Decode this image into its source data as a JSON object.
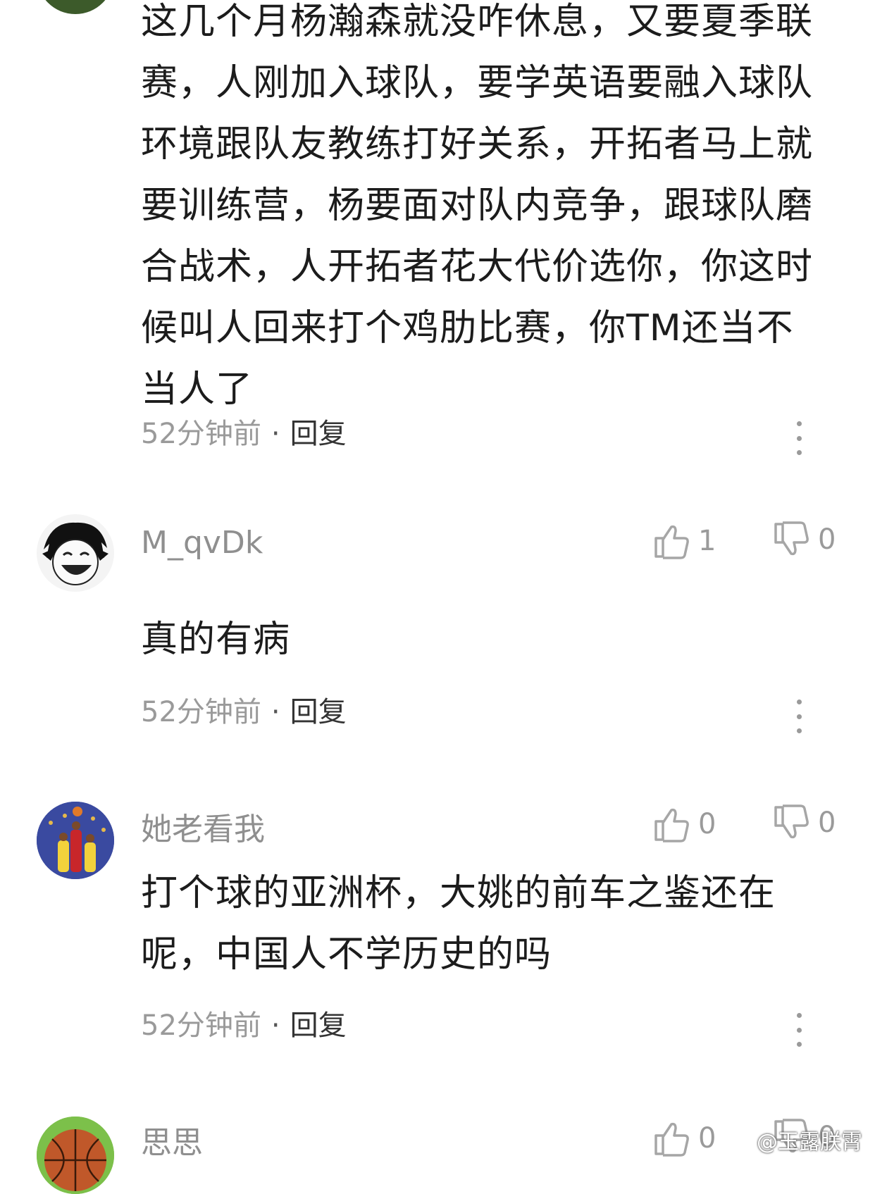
{
  "comments": [
    {
      "text": "这几个月杨瀚森就没咋休息，又要夏季联赛，人刚加入球队，要学英语要融入球队环境跟队友教练打好关系，开拓者马上就要训练营，杨要面对队内竞争，跟球队磨合战术，人开拓者花大代价选你，你这时候叫人回来打个鸡肋比赛，你TM还当不当人了",
      "time": "52分钟前",
      "reply": "回复"
    },
    {
      "username": "M_qvDk",
      "likes": "1",
      "dislikes": "0",
      "text": "真的有病",
      "time": "52分钟前",
      "reply": "回复"
    },
    {
      "username": "她老看我",
      "likes": "0",
      "dislikes": "0",
      "text": "打个球的亚洲杯，大姚的前车之鉴还在呢，中国人不学历史的吗",
      "time": "52分钟前",
      "reply": "回复"
    },
    {
      "username": "思思",
      "likes": "0",
      "dislikes": "0"
    }
  ],
  "separator": "·",
  "watermark": "@玉露朕霄",
  "icons": {
    "like": "thumbs-up-icon",
    "dislike": "thumbs-down-icon",
    "more": "more-vertical-icon"
  },
  "colors": {
    "username": "#8f8f8f",
    "meta": "#9a9a9a",
    "text": "#1c1c1c"
  }
}
